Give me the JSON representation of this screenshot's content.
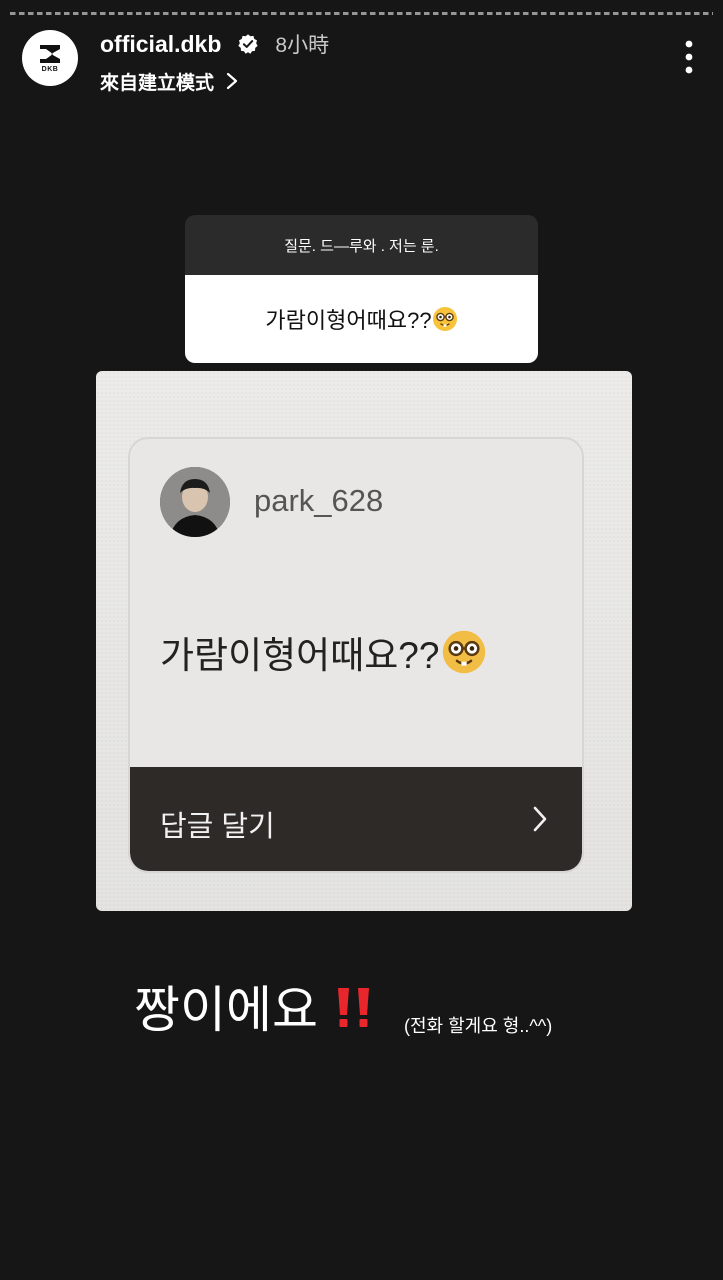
{
  "story": {
    "progress": 0.0,
    "progress_note": ""
  },
  "header": {
    "avatar_text": "DKB",
    "username": "official.dkb",
    "time": "8小時",
    "subtitle": "來自建立模式"
  },
  "question_sticker": {
    "prompt": "질문. 드—루와 . 저는 룬.",
    "answer": "가람이형어때요??"
  },
  "photo_card": {
    "username": "park_628",
    "question": "가람이형어때요??",
    "reply_label": "답글 달기"
  },
  "caption": {
    "main": "짱이에요",
    "small": "(전화 할게요 형..^^)"
  },
  "icons": {
    "verified": "verified-badge-icon",
    "more": "more-vertical-icon",
    "chevron": "chevron-right-icon",
    "emoji": "nerd-face-emoji",
    "exclaim": "double-exclamation-icon"
  },
  "colors": {
    "background": "#161616",
    "exclaim_red": "#e8262b",
    "sticker_dark": "#2b2b2b",
    "reply_bar": "#2e2a28"
  }
}
